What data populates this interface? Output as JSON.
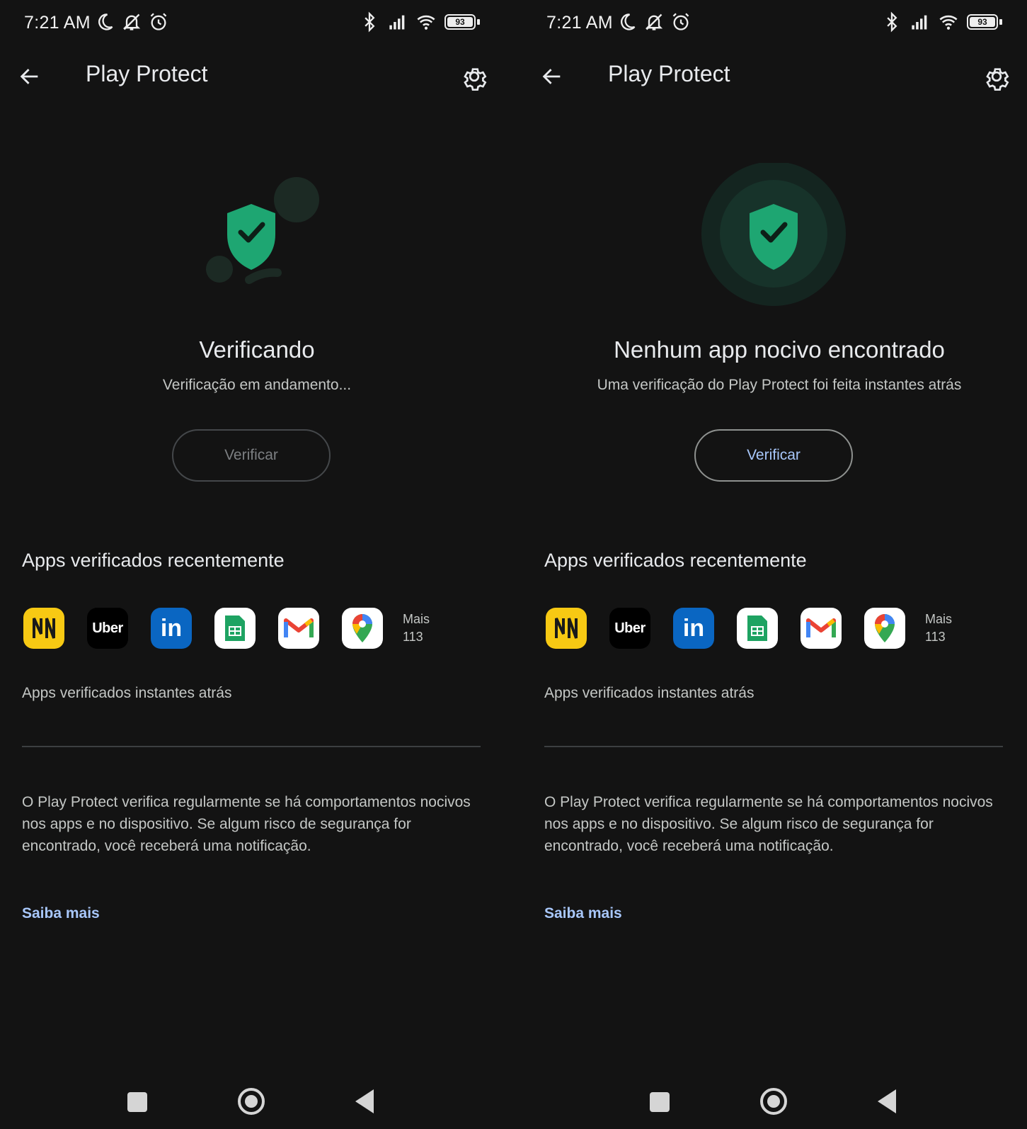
{
  "status_bar": {
    "time": "7:21 AM",
    "battery": "93"
  },
  "app_bar": {
    "title": "Play Protect"
  },
  "screens": [
    {
      "status_title": "Verificando",
      "status_subtitle": "Verificação em andamento...",
      "verify_button": "Verificar",
      "verify_enabled": false
    },
    {
      "status_title": "Nenhum app nocivo encontrado",
      "status_subtitle": "Uma verificação do Play Protect foi feita instantes atrás",
      "verify_button": "Verificar",
      "verify_enabled": true
    }
  ],
  "recent_apps": {
    "title": "Apps verificados recentemente",
    "apps": [
      {
        "name": "nubank-like-icon",
        "label": "N"
      },
      {
        "name": "uber-icon",
        "label": "Uber"
      },
      {
        "name": "linkedin-icon",
        "label": "in"
      },
      {
        "name": "sheets-icon",
        "label": ""
      },
      {
        "name": "gmail-icon",
        "label": "M"
      },
      {
        "name": "maps-icon",
        "label": ""
      }
    ],
    "more_label": "Mais",
    "more_count": "113",
    "checked_time": "Apps verificados instantes atrás"
  },
  "info": {
    "text": "O Play Protect verifica regularmente se há comportamentos nocivos nos apps e no dispositivo. Se algum risco de segurança for encontrado, você receberá uma notificação.",
    "learn_more": "Saiba mais"
  },
  "colors": {
    "background": "#131313",
    "shield": "#1ea672",
    "link": "#a8c7fa"
  }
}
